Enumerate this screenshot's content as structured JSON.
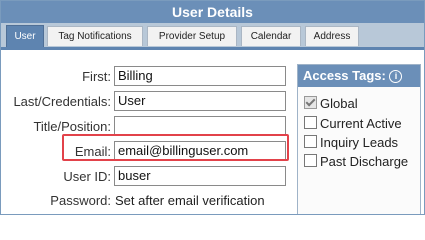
{
  "window": {
    "title": "User Details"
  },
  "tabs": [
    {
      "label": "User",
      "active": true
    },
    {
      "label": "Tag Notifications",
      "active": false
    },
    {
      "label": "Provider Setup",
      "active": false
    },
    {
      "label": "Calendar",
      "active": false
    },
    {
      "label": "Address",
      "active": false
    }
  ],
  "form": {
    "first": {
      "label": "First:",
      "value": "Billing"
    },
    "last": {
      "label": "Last/Credentials:",
      "value": "User"
    },
    "title": {
      "label": "Title/Position:",
      "value": ""
    },
    "email": {
      "label": "Email:",
      "value": "email@billinguser.com"
    },
    "user_id": {
      "label": "User ID:",
      "value": "buser"
    },
    "password": {
      "label": "Password:",
      "value": "Set after email verification"
    }
  },
  "access_tags": {
    "header": "Access Tags:",
    "info_icon": "i",
    "items": [
      {
        "label": "Global",
        "checked": true
      },
      {
        "label": "Current Active",
        "checked": false
      },
      {
        "label": "Inquiry Leads",
        "checked": false
      },
      {
        "label": "Past Discharge",
        "checked": false
      }
    ]
  },
  "colors": {
    "accent": "#6b8fb8",
    "highlight": "#e2424a"
  }
}
